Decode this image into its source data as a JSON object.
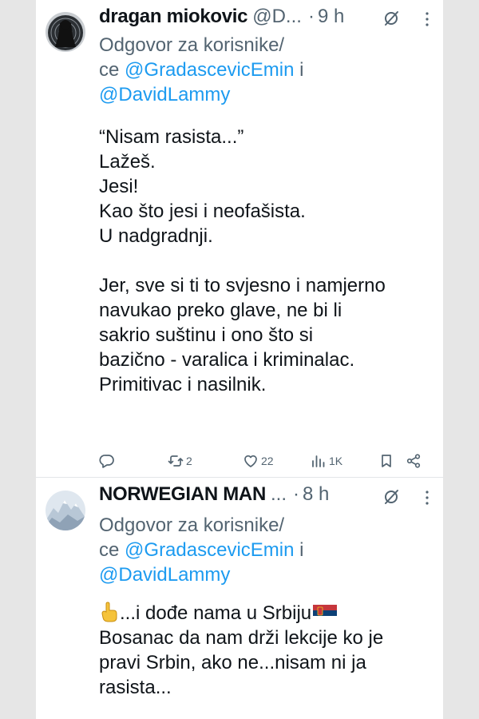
{
  "tweets": [
    {
      "name": "dragan miokovic",
      "handle": "@D...",
      "separator": "·",
      "time": "9 h",
      "reply_prefix_line1": "Odgovor za korisnike/",
      "reply_prefix_line2": "ce",
      "mention1": "@GradascevicEmin",
      "conjunction": "i",
      "mention2": "@DavidLammy",
      "body_lines": [
        "“Nisam rasista...”",
        "Lažeš.",
        "Jesi!",
        "Kao što jesi i neofašista.",
        "U nadgradnji.",
        "",
        "Jer, sve si ti to svjesno i namjerno",
        "navukao preko glave, ne bi li",
        "sakrio suštinu i ono što si",
        "bazično - varalica i kriminalac.",
        "Primitivac i nasilnik."
      ],
      "actions": {
        "replies": "",
        "reposts": "2",
        "likes": "22",
        "views": "1K"
      },
      "avatar_icon": "shooting-target-icon"
    },
    {
      "name": "NORWEGIAN MAN",
      "handle": "...",
      "separator": "·",
      "time": "8 h",
      "reply_prefix_line1": "Odgovor za korisnike/",
      "reply_prefix_line2": "ce",
      "mention1": "@GradascevicEmin",
      "conjunction": "i",
      "mention2": "@DavidLammy",
      "body_line1_text": "...i dođe nama u Srbiju",
      "body_lines": [
        "Bosanac da nam drži lekcije ko je",
        "pravi Srbin, ako ne...nisam ni ja",
        "rasista..."
      ],
      "emoji": [
        "pointing-up-hand-icon",
        "serbia-flag-icon"
      ],
      "avatar_icon": "mountain-photo-icon"
    }
  ],
  "colors": {
    "text": "#0f1419",
    "secondary": "#536471",
    "link": "#1d9bf0",
    "background": "#ffffff"
  }
}
